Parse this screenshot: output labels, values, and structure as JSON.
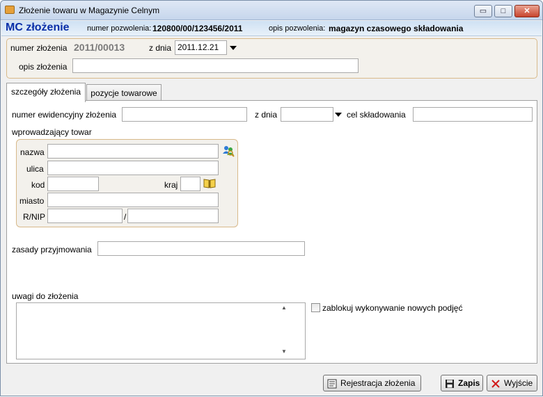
{
  "window": {
    "title": "Złożenie towaru w Magazynie Celnym",
    "controls": {
      "minimize": "▭",
      "maximize": "□",
      "close": "✕"
    }
  },
  "header": {
    "title": "MC złożenie",
    "permit_number_label": "numer pozwolenia:",
    "permit_number_value": "120800/00/123456/2011",
    "permit_desc_label": "opis pozwolenia:",
    "permit_desc_value": "magazyn czasowego składowania"
  },
  "top_form": {
    "number_label": "numer złożenia",
    "number_value": "2011/00013",
    "date_label": "z dnia",
    "date_value": "2011.12.21",
    "desc_label": "opis złożenia",
    "desc_value": ""
  },
  "tabs": [
    {
      "label": "szczegóły złożenia",
      "active": true
    },
    {
      "label": "pozycje towarowe",
      "active": false
    }
  ],
  "details": {
    "evidence_number_label": "numer ewidencyjny złożenia",
    "evidence_number_value": "",
    "date_label": "z dnia",
    "date_value": "",
    "purpose_label": "cel składowania",
    "purpose_value": "",
    "introducer_label": "wprowadzający towar",
    "name_label": "nazwa",
    "name_value": "",
    "street_label": "ulica",
    "street_value": "",
    "postcode_label": "kod",
    "postcode_value": "",
    "country_label": "kraj",
    "country_value": "",
    "city_label": "miasto",
    "city_value": "",
    "nip_label": "R/NIP",
    "nip_value_1": "",
    "nip_separator": "/",
    "nip_value_2": "",
    "acceptance_label": "zasady przyjmowania",
    "acceptance_value": "",
    "notes_label": "uwagi do złożenia",
    "notes_value": "",
    "block_checkbox_label": "zablokuj wykonywanie nowych podjęć",
    "block_checkbox_checked": false
  },
  "buttons": {
    "register": "Rejestracja złożenia",
    "save": "Zapis",
    "exit": "Wyjście"
  },
  "colors": {
    "header_title": "#0a2fa8",
    "group_border": "#d8b98a",
    "exit_icon": "#d11a1a"
  },
  "icons": {
    "app": "package-icon",
    "contractor_lookup": "people-search-icon",
    "country_lookup": "book-icon",
    "register": "register-icon",
    "save": "floppy-disk-icon",
    "exit": "red-x-icon"
  }
}
